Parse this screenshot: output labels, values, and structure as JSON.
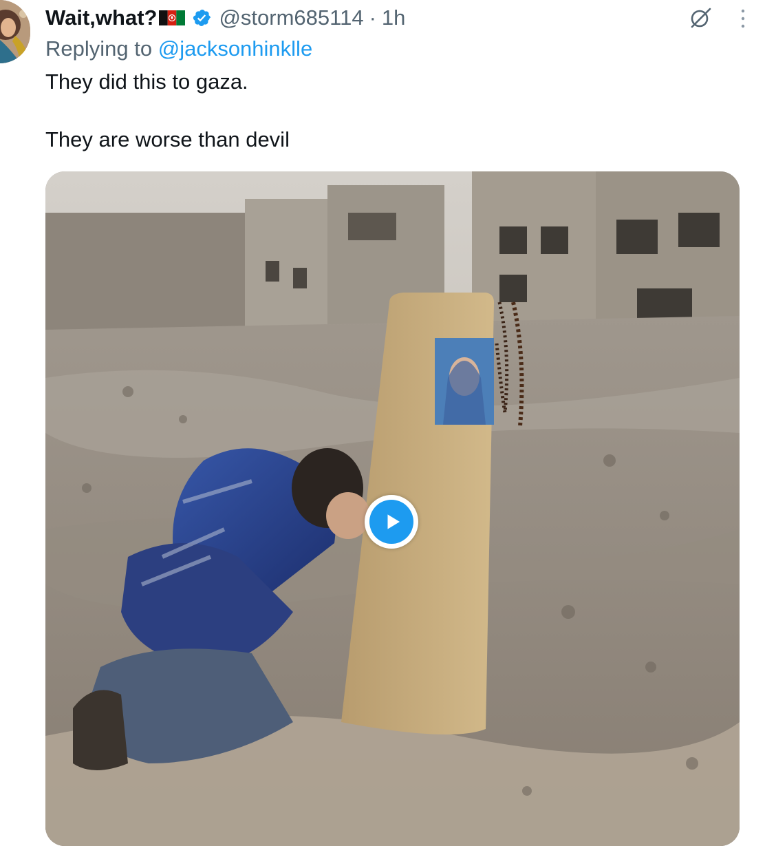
{
  "tweet": {
    "display_name": "Wait,what?",
    "flag_icon": "afghanistan-flag-icon",
    "verified_icon": "verified-badge-icon",
    "handle": "@storm685114",
    "separator": "·",
    "time": "1h",
    "replying_prefix": "Replying to ",
    "replying_to": "@jacksonhinklle",
    "text_lines": [
      "They did this to gaza.",
      "They are worse than devil"
    ]
  },
  "toolbar": {
    "grok_icon": "grok-icon",
    "more_icon": "more-vertical-icon"
  },
  "media": {
    "type": "video",
    "play_icon": "play-icon"
  },
  "colors": {
    "text": "#0f1419",
    "secondary": "#536471",
    "link": "#1d9bf0",
    "play_button": "#1d9bf0"
  }
}
